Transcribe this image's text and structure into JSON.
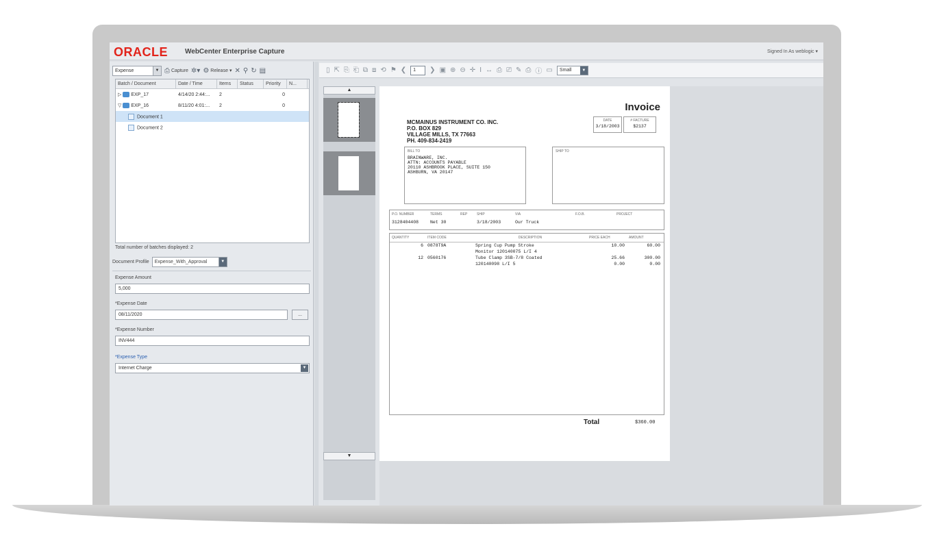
{
  "app": {
    "brand": "ORACLE",
    "title": "WebCenter Enterprise Capture",
    "signed_in": "Signed In As weblogic ▾"
  },
  "left_toolbar": {
    "workspace": "Expense",
    "capture_label": "Capture",
    "release_label": "Release"
  },
  "batch_grid": {
    "columns": [
      "Batch / Document",
      "Date / Time",
      "Items",
      "Status",
      "Priority",
      "N..."
    ],
    "rows": [
      {
        "name": "EXP_17",
        "date": "4/14/20 2:44:...",
        "items": "2",
        "status": "",
        "priority": "0"
      },
      {
        "name": "EXP_16",
        "date": "8/11/20 4:01:...",
        "items": "2",
        "status": "",
        "priority": "0"
      }
    ],
    "documents": [
      "Document 1",
      "Document 2"
    ],
    "total_text": "Total number of batches displayed: 2"
  },
  "profile": {
    "label": "Document Profile",
    "value": "Expense_With_Approval"
  },
  "form": {
    "amount_label": "Expense Amount",
    "amount_value": "5,000",
    "date_label": "*Expense Date",
    "date_value": "08/11/2020",
    "date_button": "...",
    "number_label": "*Expense Number",
    "number_value": "INV444",
    "type_label": "*Expense Type",
    "type_value": "Internet Charge"
  },
  "viewer": {
    "page_number": "1",
    "zoom": "Small"
  },
  "invoice": {
    "title": "Invoice",
    "company": [
      "MCMAINUS INSTRUMENT CO. INC.",
      "P.O. BOX 829",
      "VILLAGE MILLS, TX 77663",
      "PH. 409-834-2419"
    ],
    "date_label": "DATE",
    "date_value": "3/18/2003",
    "invoice_label": "# FACTURE",
    "invoice_value": "$2137",
    "bill_to_label": "BILL TO",
    "bill_to": [
      "BRAINWARE, INC.",
      "ATTN: ACCOUNTS PAYABLE",
      "20110 ASHBROOK PLACE, SUITE 150",
      "ASHBURN, VA 20147"
    ],
    "ship_to_label": "SHIP TO",
    "meta_headers": [
      "P.O. NUMBER",
      "TERMS",
      "REP",
      "SHIP",
      "VIA",
      "F.O.B.",
      "PROJECT"
    ],
    "meta_values": [
      "3128404408",
      "Net 30",
      "",
      "3/18/2003",
      "Our Truck",
      "",
      ""
    ],
    "item_headers": [
      "QUANTITY",
      "ITEM CODE",
      "DESCRIPTION",
      "PRICE EACH",
      "AMOUNT"
    ],
    "items": [
      {
        "qty": "6",
        "code": "0878T9A",
        "desc": "Spring Cup Pump Stroke",
        "price": "10.00",
        "amount": "60.00"
      },
      {
        "qty": "",
        "code": "",
        "desc": "Monitor 120140075 L/I 4",
        "price": "",
        "amount": ""
      },
      {
        "qty": "12",
        "code": "0560176",
        "desc": "Tube Clamp 3SB-7/8 Coated",
        "price": "25.66",
        "amount": "300.00"
      },
      {
        "qty": "",
        "code": "",
        "desc": "120140098 L/I 5",
        "price": "0.00",
        "amount": "0.00"
      }
    ],
    "total_label": "Total",
    "total_value": "$360.00"
  }
}
